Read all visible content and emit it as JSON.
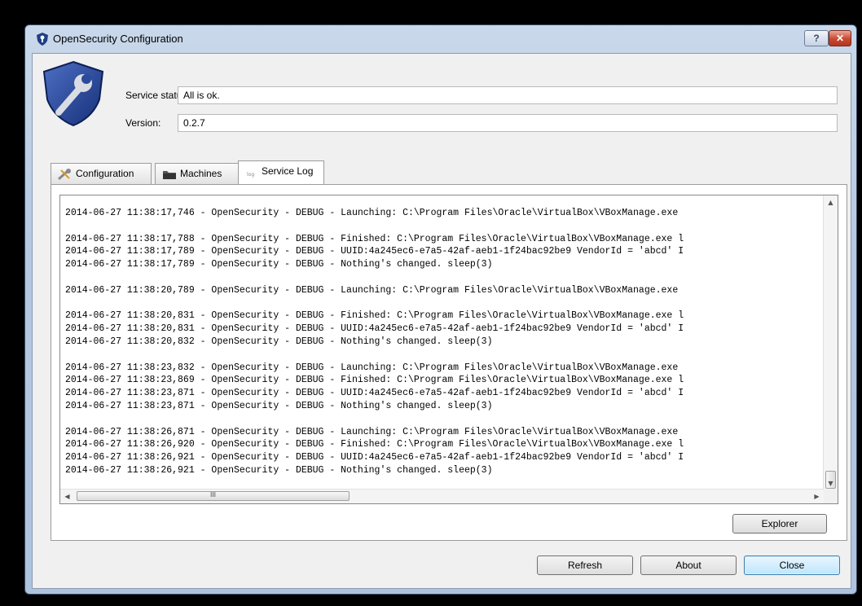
{
  "window": {
    "title": "OpenSecurity Configuration",
    "help_label": "?",
    "close_label": "✕"
  },
  "status": {
    "service_label": "Service status:",
    "service_value": "All is ok.",
    "version_label": "Version:",
    "version_value": "0.2.7"
  },
  "tabs": [
    {
      "label": "Configuration",
      "icon": "wrench-icon",
      "active": false
    },
    {
      "label": "Machines",
      "icon": "folder-icon",
      "active": false
    },
    {
      "label": "Service Log",
      "icon": "log-icon",
      "active": true
    }
  ],
  "log": {
    "text": "2014-06-27 11:38:17,746 - OpenSecurity - DEBUG - Launching: C:\\Program Files\\Oracle\\VirtualBox\\VBoxManage.exe\n\n2014-06-27 11:38:17,788 - OpenSecurity - DEBUG - Finished: C:\\Program Files\\Oracle\\VirtualBox\\VBoxManage.exe l\n2014-06-27 11:38:17,789 - OpenSecurity - DEBUG - UUID:4a245ec6-e7a5-42af-aeb1-1f24bac92be9 VendorId = 'abcd' I\n2014-06-27 11:38:17,789 - OpenSecurity - DEBUG - Nothing's changed. sleep(3)\n\n2014-06-27 11:38:20,789 - OpenSecurity - DEBUG - Launching: C:\\Program Files\\Oracle\\VirtualBox\\VBoxManage.exe\n\n2014-06-27 11:38:20,831 - OpenSecurity - DEBUG - Finished: C:\\Program Files\\Oracle\\VirtualBox\\VBoxManage.exe l\n2014-06-27 11:38:20,831 - OpenSecurity - DEBUG - UUID:4a245ec6-e7a5-42af-aeb1-1f24bac92be9 VendorId = 'abcd' I\n2014-06-27 11:38:20,832 - OpenSecurity - DEBUG - Nothing's changed. sleep(3)\n\n2014-06-27 11:38:23,832 - OpenSecurity - DEBUG - Launching: C:\\Program Files\\Oracle\\VirtualBox\\VBoxManage.exe\n2014-06-27 11:38:23,869 - OpenSecurity - DEBUG - Finished: C:\\Program Files\\Oracle\\VirtualBox\\VBoxManage.exe l\n2014-06-27 11:38:23,871 - OpenSecurity - DEBUG - UUID:4a245ec6-e7a5-42af-aeb1-1f24bac92be9 VendorId = 'abcd' I\n2014-06-27 11:38:23,871 - OpenSecurity - DEBUG - Nothing's changed. sleep(3)\n\n2014-06-27 11:38:26,871 - OpenSecurity - DEBUG - Launching: C:\\Program Files\\Oracle\\VirtualBox\\VBoxManage.exe\n2014-06-27 11:38:26,920 - OpenSecurity - DEBUG - Finished: C:\\Program Files\\Oracle\\VirtualBox\\VBoxManage.exe l\n2014-06-27 11:38:26,921 - OpenSecurity - DEBUG - UUID:4a245ec6-e7a5-42af-aeb1-1f24bac92be9 VendorId = 'abcd' I\n2014-06-27 11:38:26,921 - OpenSecurity - DEBUG - Nothing's changed. sleep(3)",
    "hscroll_thumb_label": "III"
  },
  "buttons": {
    "explorer": "Explorer",
    "refresh": "Refresh",
    "about": "About",
    "close": "Close"
  },
  "colors": {
    "accent": "#3c7fb1",
    "titlebar": "#b6c9e2",
    "close_button": "#c84730"
  }
}
